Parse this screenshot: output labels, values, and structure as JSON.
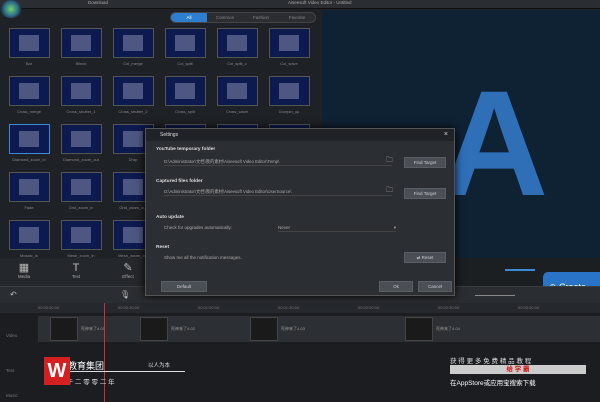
{
  "topbar": {
    "download": "Download",
    "title": "Aiseesoft Video Editor - Untitled"
  },
  "tabs": [
    {
      "label": "All",
      "active": true
    },
    {
      "label": "Common"
    },
    {
      "label": "Fashion"
    },
    {
      "label": "Favorite"
    }
  ],
  "transitions": [
    "Bar",
    "Blinds",
    "Col_merge",
    "Col_split",
    "Col_split_c",
    "Col_wave",
    "Cross_merge",
    "Cross_shutter_1",
    "Cross_shutter_2",
    "Cross_split",
    "Cross_wave",
    "Doorpin_up",
    "Diamond_zoom_in",
    "Diamond_zoom_out",
    "Drop",
    "",
    "",
    "",
    "Fade",
    "Grid_zoom_in",
    "Grid_zoom_out",
    "",
    "",
    "",
    "Mosaic_in",
    "Mesh_zoom_in",
    "Mesh_zoom_out",
    "",
    "",
    ""
  ],
  "preview": {
    "letter": "A"
  },
  "tools": [
    {
      "icon": "▦",
      "label": "Media"
    },
    {
      "icon": "T",
      "label": "Text"
    },
    {
      "icon": "✎",
      "label": "Effect"
    }
  ],
  "create": "Create",
  "dialog": {
    "title": "Settings",
    "yt_heading": "YouTube temporary folder",
    "yt_path": "D:\\Administrator\\文档\\我的素材\\Aiseesoft Video Editor\\Temp\\",
    "cap_heading": "Captured files folder",
    "cap_path": "D:\\Administrator\\文档\\我的素材\\Aiseesoft Video Editor\\UserSource\\",
    "find_target": "Find Target",
    "auto_heading": "Auto update",
    "auto_label": "Check for upgrades automatically:",
    "auto_value": "Never",
    "reset_heading": "Reset",
    "reset_label": "Show me all the notification messages.",
    "reset_btn": "Reset",
    "default_btn": "Default",
    "ok_btn": "Ok",
    "cancel_btn": "Cancel"
  },
  "timeline": {
    "timecodes": [
      "00:00:00:00",
      "00:00:30:00",
      "00:01:00:00",
      "00:01:30:00",
      "00:02:00:00",
      "00:02:30:00",
      "00:03:00:00"
    ],
    "tracks": [
      "Video",
      "Text",
      "Music"
    ],
    "clips": [
      "死神来了4-01",
      "死神来了4-02",
      "死神来了4-03",
      "死神来了4-04"
    ]
  },
  "watermark": {
    "logo": "W",
    "name": "王氏教育集团",
    "motto": "以人为本",
    "since": "始 创 于 二 零 零 二 年",
    "r1": "获 得 更 多 免 费 精 品 教 程",
    "r2": "给 学 霸",
    "r3": "在AppStore或应用宝搜索下载"
  }
}
